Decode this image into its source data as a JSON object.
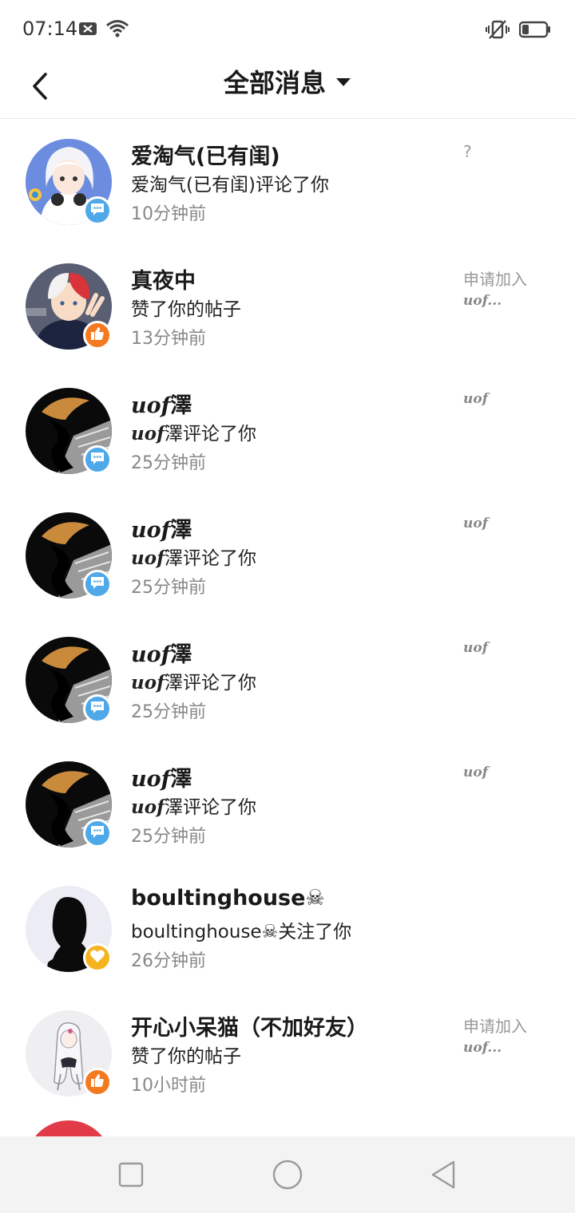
{
  "status_bar": {
    "time": "07:14",
    "icons_left": [
      "x-notification-icon",
      "wifi-icon"
    ],
    "icons_right": [
      "vibrate-mute-icon",
      "battery-icon"
    ]
  },
  "header": {
    "title": "全部消息",
    "back_icon": "chevron-left-icon",
    "dropdown_icon": "caret-down-icon"
  },
  "colors": {
    "comment_badge": "#4FA8E8",
    "like_badge": "#F47A20",
    "follow_badge": "#F5B320",
    "secondary_text": "#888888",
    "divider": "#E5E5E5",
    "nav_bg": "#F3F3F3"
  },
  "messages": [
    {
      "name": "爱淘气(已有闺)",
      "action": "爱淘气(已有闺)评论了你",
      "time": "10分钟前",
      "badge": "comment",
      "right_line1": "?",
      "right_line2": ""
    },
    {
      "name": "真夜中",
      "action": "赞了你的帖子",
      "time": "13分钟前",
      "badge": "like",
      "right_line1": "申请加入",
      "right_line2": "uof..."
    },
    {
      "name_prefix": "uof",
      "name_suffix": "澤",
      "action_prefix": "uof",
      "action_suffix": "澤评论了你",
      "time": "25分钟前",
      "badge": "comment",
      "right_line1": "",
      "right_line2": "uof"
    },
    {
      "name_prefix": "uof",
      "name_suffix": "澤",
      "action_prefix": "uof",
      "action_suffix": "澤评论了你",
      "time": "25分钟前",
      "badge": "comment",
      "right_line1": "",
      "right_line2": "uof"
    },
    {
      "name_prefix": "uof",
      "name_suffix": "澤",
      "action_prefix": "uof",
      "action_suffix": "澤评论了你",
      "time": "25分钟前",
      "badge": "comment",
      "right_line1": "",
      "right_line2": "uof"
    },
    {
      "name_prefix": "uof",
      "name_suffix": "澤",
      "action_prefix": "uof",
      "action_suffix": "澤评论了你",
      "time": "25分钟前",
      "badge": "comment",
      "right_line1": "",
      "right_line2": "uof"
    },
    {
      "name": "boultinghouse☠",
      "action": "boultinghouse☠关注了你",
      "time": "26分钟前",
      "badge": "follow",
      "right_line1": "",
      "right_line2": ""
    },
    {
      "name": "开心小呆猫（不加好友）",
      "action": "赞了你的帖子",
      "time": "10小时前",
      "badge": "like",
      "right_line1": "申请加入",
      "right_line2": "uof..."
    }
  ],
  "nav_bar": {
    "icons": [
      "recent-apps-square-icon",
      "home-circle-icon",
      "back-triangle-icon"
    ]
  }
}
